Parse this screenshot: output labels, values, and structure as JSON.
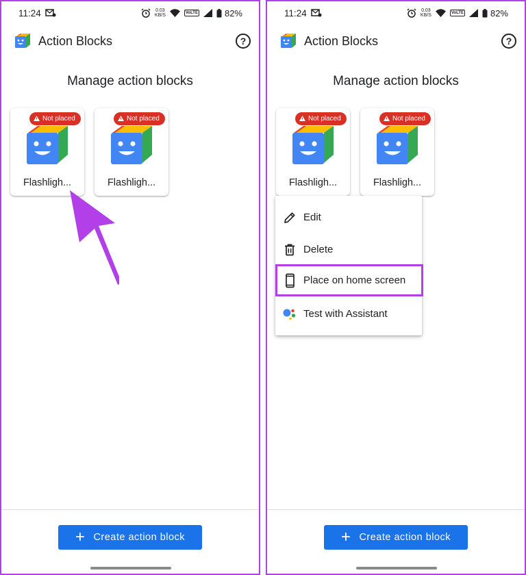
{
  "status": {
    "time": "11:24",
    "data_rate_top": "0.03",
    "data_rate_unit": "KB/S",
    "volte": "VoLTE",
    "battery": "82%"
  },
  "app": {
    "title": "Action Blocks",
    "help_icon": "?"
  },
  "page": {
    "title": "Manage action blocks"
  },
  "blocks": [
    {
      "label": "Flashligh...",
      "badge": "Not placed"
    },
    {
      "label": "Flashligh...",
      "badge": "Not placed"
    }
  ],
  "menu": {
    "items": [
      {
        "label": "Edit",
        "icon": "pencil-icon"
      },
      {
        "label": "Delete",
        "icon": "trash-icon"
      },
      {
        "label": "Place on home screen",
        "icon": "phone-icon"
      },
      {
        "label": "Test with Assistant",
        "icon": "assistant-icon"
      }
    ]
  },
  "footer": {
    "create_label": "Create action block",
    "plus": "+"
  },
  "colors": {
    "accent": "#1a73e8",
    "badge": "#d93025",
    "highlight": "#b23fe8"
  }
}
